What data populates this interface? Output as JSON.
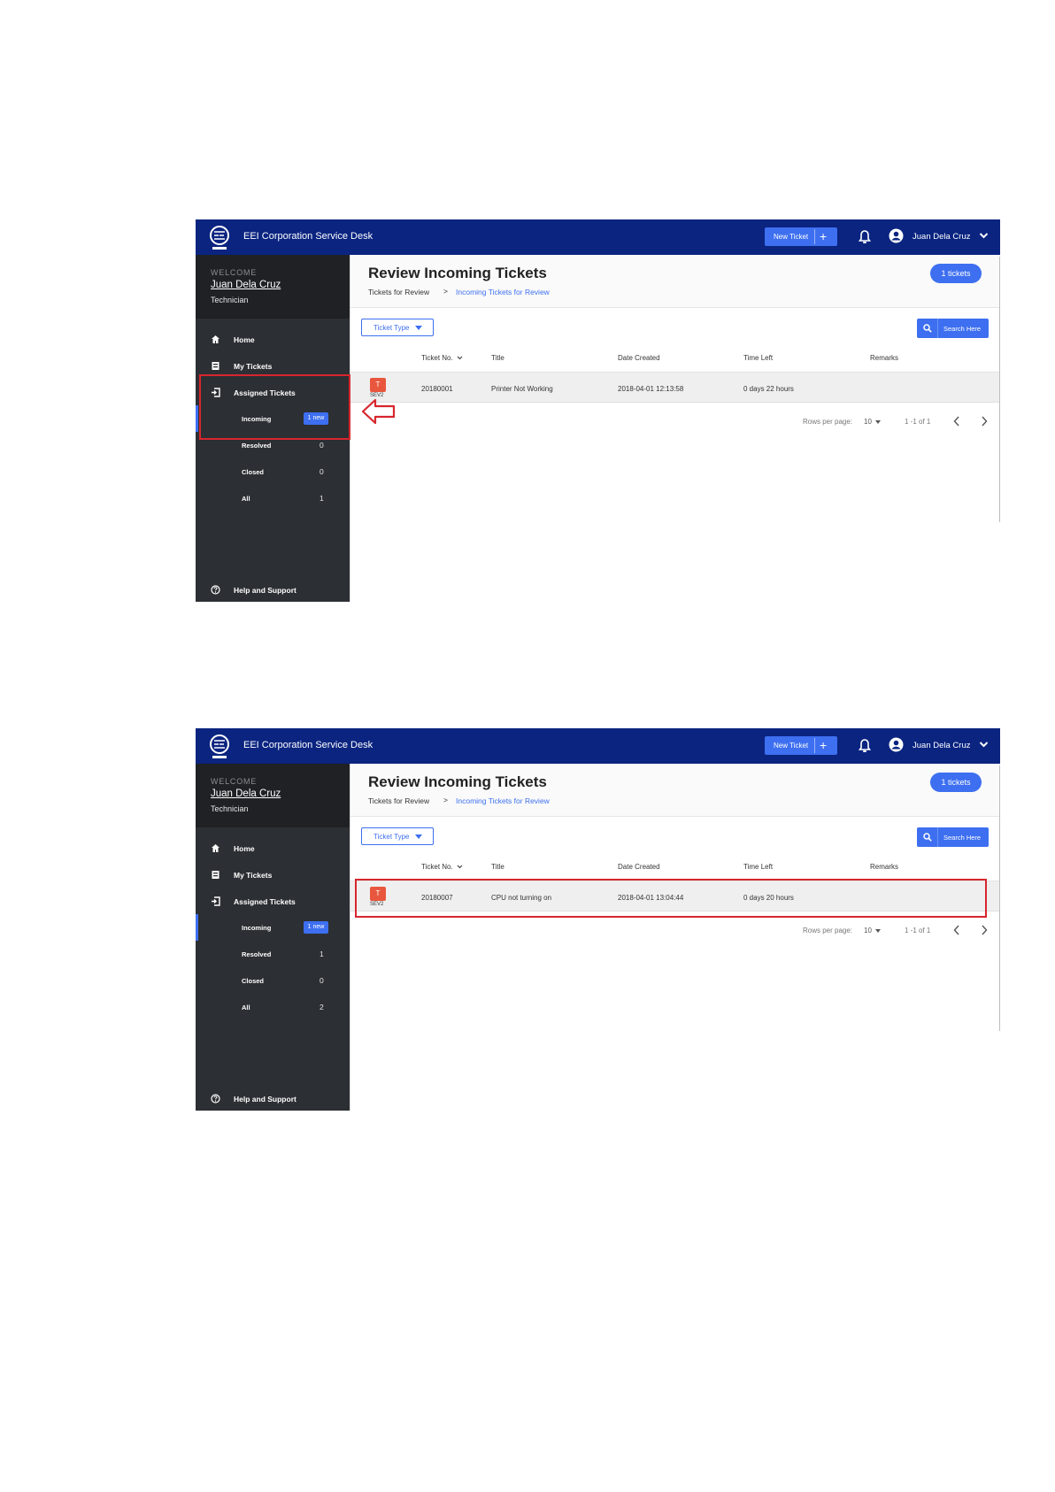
{
  "shots": [
    {
      "app_title": "EEI Corporation Service Desk",
      "new_ticket_label": "New Ticket",
      "user_name": "Juan Dela Cruz",
      "welcome_label": "WELCOME",
      "welcome_name": "Juan Dela Cruz",
      "welcome_role": "Technician",
      "nav": {
        "home": "Home",
        "my_tickets": "My Tickets",
        "assigned_tickets": "Assigned Tickets",
        "help": "Help and Support"
      },
      "sub": {
        "incoming": "Incoming",
        "incoming_badge": "1 new",
        "resolved": "Resolved",
        "resolved_count": "0",
        "closed": "Closed",
        "closed_count": "0",
        "all": "All",
        "all_count": "1"
      },
      "page_title": "Review Incoming Tickets",
      "breadcrumb": [
        "Tickets for Review",
        ">",
        "Incoming Tickets for Review"
      ],
      "ticket_count": "1 tickets",
      "ticket_type_label": "Ticket Type",
      "search_label": "Search Here",
      "columns": [
        "Ticket No.",
        "Title",
        "Date Created",
        "Time Left",
        "Remarks"
      ],
      "row": {
        "sev_icon": "T",
        "sev_label": "SEV2",
        "ticket_no": "20180001",
        "title": "Printer Not Working",
        "date_created": "2018-04-01 12:13:58",
        "time_left": "0 days 22 hours",
        "remarks": ""
      },
      "pager": {
        "rows_per_page_label": "Rows per page:",
        "rows_per_page": "10",
        "range": "1 -1 of 1"
      }
    },
    {
      "app_title": "EEI Corporation Service Desk",
      "new_ticket_label": "New Ticket",
      "user_name": "Juan Dela Cruz",
      "welcome_label": "WELCOME",
      "welcome_name": "Juan Dela Cruz",
      "welcome_role": "Technician",
      "nav": {
        "home": "Home",
        "my_tickets": "My Tickets",
        "assigned_tickets": "Assigned Tickets",
        "help": "Help and Support"
      },
      "sub": {
        "incoming": "Incoming",
        "incoming_badge": "1 new",
        "resolved": "Resolved",
        "resolved_count": "1",
        "closed": "Closed",
        "closed_count": "0",
        "all": "All",
        "all_count": "2"
      },
      "page_title": "Review Incoming Tickets",
      "breadcrumb": [
        "Tickets for Review",
        ">",
        "Incoming Tickets for Review"
      ],
      "ticket_count": "1 tickets",
      "ticket_type_label": "Ticket Type",
      "search_label": "Search Here",
      "columns": [
        "Ticket No.",
        "Title",
        "Date Created",
        "Time Left",
        "Remarks"
      ],
      "row": {
        "sev_icon": "T",
        "sev_label": "SEV2",
        "ticket_no": "20180007",
        "title": "CPU not turning on",
        "date_created": "2018-04-01 13:04:44",
        "time_left": "0 days 20 hours",
        "remarks": ""
      },
      "pager": {
        "rows_per_page_label": "Rows per page:",
        "rows_per_page": "10",
        "range": "1 -1 of 1"
      }
    }
  ],
  "colors": {
    "topbar": "#0a2480",
    "accent": "#3d6ff0",
    "sidebar": "#2c2f33",
    "highlight": "#d7262e",
    "severity": "#e8573d"
  }
}
